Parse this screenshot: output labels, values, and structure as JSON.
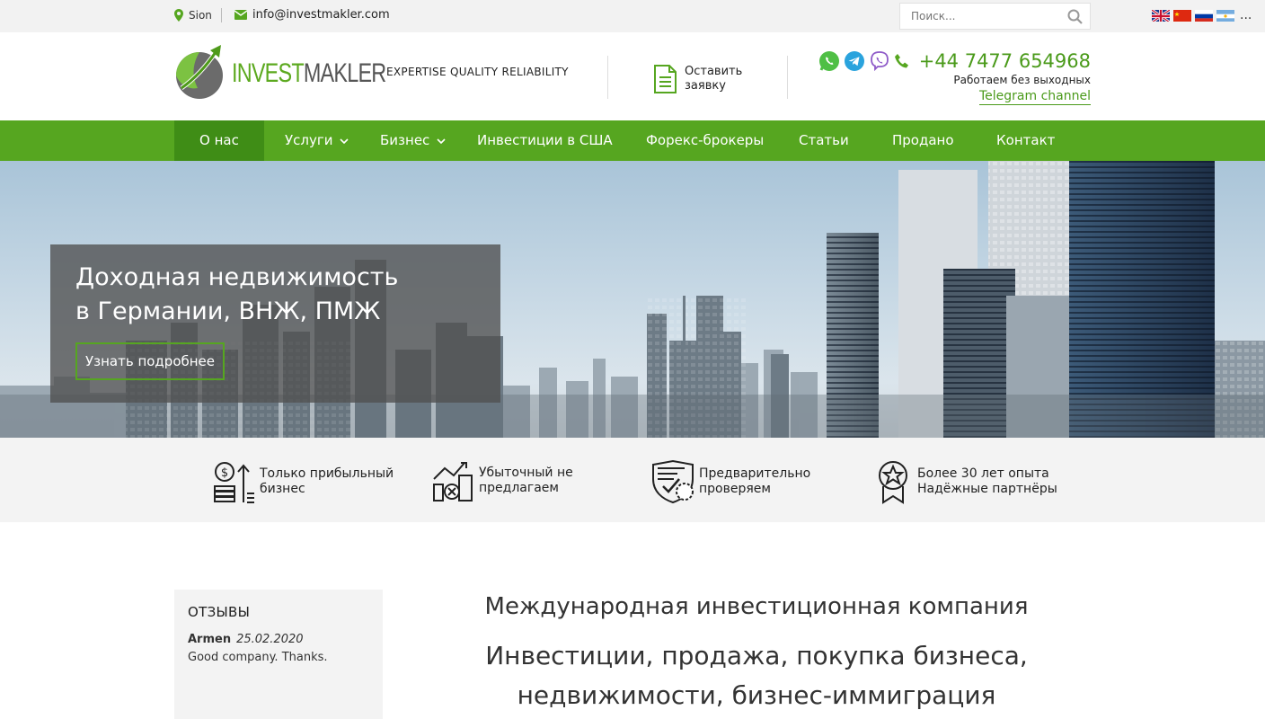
{
  "topbar": {
    "location": "Sion",
    "email": "info@investmakler.com",
    "search_placeholder": "Поиск...",
    "more_languages": "...",
    "flags": [
      "uk-flag",
      "china-flag",
      "russia-flag",
      "argentina-flag"
    ]
  },
  "header": {
    "logo_part1": "INVEST",
    "logo_part2": "MAKLER",
    "tagline": "EXPERTISE QUALITY RELIABILITY",
    "request_label": "Оставить заявку",
    "phone": "+44 7477 654968",
    "hours": "Работаем без выходных",
    "telegram": "Telegram channel"
  },
  "nav": {
    "items": [
      {
        "label": "О нас"
      },
      {
        "label": "Услуги"
      },
      {
        "label": "Бизнес"
      },
      {
        "label": "Инвестиции в США"
      },
      {
        "label": "Форекс-брокеры"
      },
      {
        "label": "Статьи"
      },
      {
        "label": "Продано"
      },
      {
        "label": "Контакт"
      }
    ]
  },
  "hero": {
    "title_line1": "Доходная недвижимость",
    "title_line2": "в Германии, ВНЖ, ПМЖ",
    "button": "Узнать подробнее"
  },
  "features": [
    {
      "line1": "Только прибыльный",
      "line2": "бизнес"
    },
    {
      "line1": "Убыточный не",
      "line2": "предлагаем"
    },
    {
      "line1": "Предварительно",
      "line2": "проверяем"
    },
    {
      "line1": "Более 30 лет опыта",
      "line2": "Надёжные партнёры"
    }
  ],
  "reviews": {
    "title": "ОТЗЫВЫ",
    "author": "Armen",
    "date": "25.02.2020",
    "text": "Good company. Thanks."
  },
  "main": {
    "heading": "Международная инвестиционная компания",
    "sub_line1": "Инвестиции, продажа, покупка бизнеса,",
    "sub_line2": "недвижимости, бизнес-иммиграция"
  },
  "colors": {
    "brand_green": "#56a620",
    "nav_active": "#3f8d16"
  }
}
